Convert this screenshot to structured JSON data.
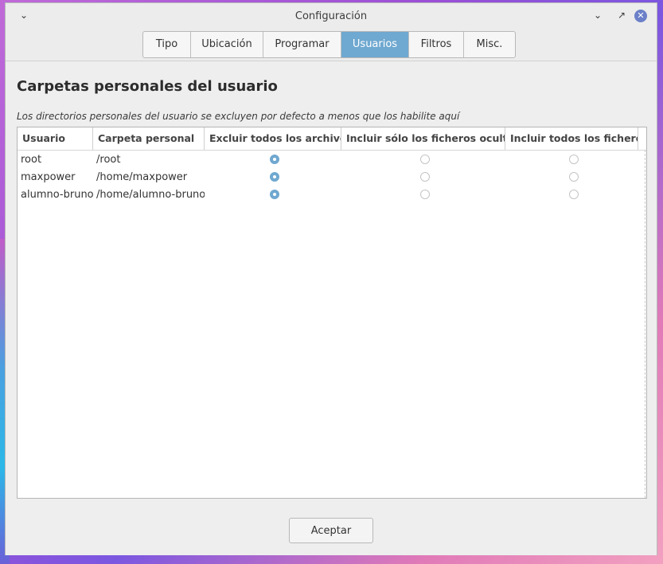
{
  "window": {
    "title": "Configuración"
  },
  "tabs": [
    {
      "label": "Tipo",
      "active": false
    },
    {
      "label": "Ubicación",
      "active": false
    },
    {
      "label": "Programar",
      "active": false
    },
    {
      "label": "Usuarios",
      "active": true
    },
    {
      "label": "Filtros",
      "active": false
    },
    {
      "label": "Misc.",
      "active": false
    }
  ],
  "main": {
    "heading": "Carpetas personales del usuario",
    "description": "Los directorios personales del usuario se excluyen por defecto a menos que los habilite aquí",
    "columns": [
      "Usuario",
      "Carpeta personal",
      "Excluir todos los archivos",
      "Incluir sólo los ficheros ocultos",
      "Incluir todos los ficheros"
    ],
    "rows": [
      {
        "user": "root",
        "home": "/root",
        "selected": "exclude_all"
      },
      {
        "user": "maxpower",
        "home": "/home/maxpower",
        "selected": "exclude_all"
      },
      {
        "user": "alumno-bruno",
        "home": "/home/alumno-bruno",
        "selected": "exclude_all"
      }
    ],
    "accept_label": "Aceptar"
  },
  "colors": {
    "accent": "#6fa8d0",
    "close_button": "#6b80c8"
  }
}
